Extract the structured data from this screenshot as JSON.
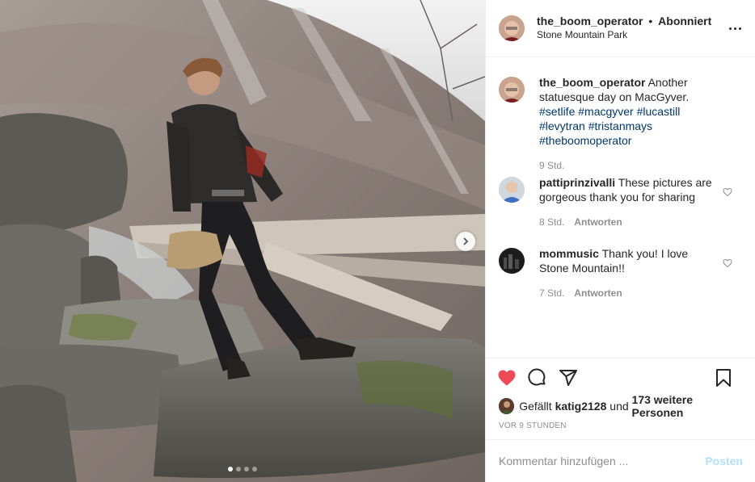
{
  "header": {
    "username": "the_boom_operator",
    "separator": "•",
    "follow_status": "Abonniert",
    "location": "Stone Mountain Park"
  },
  "caption": {
    "username": "the_boom_operator",
    "text": "Another statuesque day on MacGyver.",
    "hashtags": [
      "#setlife",
      "#macgyver",
      "#lucastill",
      "#levytran",
      "#tristanmays",
      "#theboomoperator"
    ],
    "time": "9 Std."
  },
  "comments": [
    {
      "username": "pattiprinzivalli",
      "text": "These pictures are gorgeous thank you for sharing",
      "time": "8 Std.",
      "reply_label": "Antworten"
    },
    {
      "username": "mommusic",
      "text": "Thank you! I love Stone Mountain!!",
      "time": "7 Std.",
      "reply_label": "Antworten"
    }
  ],
  "likes": {
    "prefix": "Gefällt",
    "first_user": "katig2128",
    "joiner": "und",
    "others": "173 weitere Personen"
  },
  "timestamp": "VOR 9 STUNDEN",
  "add_comment": {
    "placeholder": "Kommentar hinzufügen ...",
    "post_label": "Posten"
  },
  "carousel": {
    "count": 4,
    "active": 0
  },
  "colors": {
    "like_red": "#ed4956",
    "link": "#00376b",
    "post_disabled": "#b2dffc",
    "muted": "#8e8e8e"
  },
  "icons": [
    "heart-icon",
    "comment-icon",
    "share-icon",
    "bookmark-icon",
    "more-icon",
    "chevron-right-icon"
  ]
}
